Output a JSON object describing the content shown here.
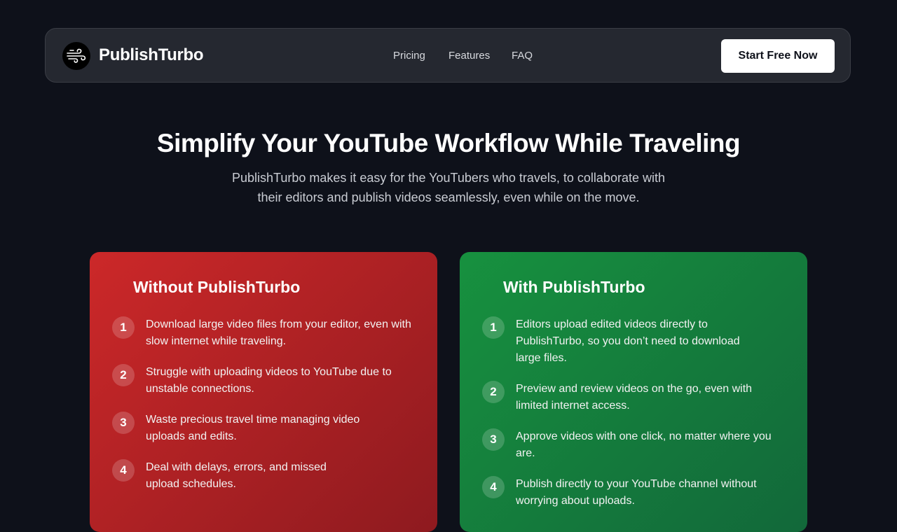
{
  "nav": {
    "brand": "PublishTurbo",
    "logo_icon": "wind-icon",
    "links": [
      "Pricing",
      "Features",
      "FAQ"
    ],
    "cta_label": "Start Free Now"
  },
  "hero": {
    "title": "Simplify Your YouTube Workflow While Traveling",
    "subtitle_line1": "PublishTurbo makes it easy for the YouTubers who travels, to collaborate with",
    "subtitle_line2": "their editors and publish videos seamlessly, even while on the move."
  },
  "without": {
    "title": "Without PublishTurbo",
    "color": "#cc2829",
    "items": [
      {
        "num": "1",
        "text": "Download large video files from your editor, even with slow internet while traveling."
      },
      {
        "num": "2",
        "text": "Struggle with uploading videos to YouTube due to unstable connections."
      },
      {
        "num": "3",
        "text": "Waste precious travel time managing video uploads and edits."
      },
      {
        "num": "4",
        "text": "Deal with delays, errors, and missed upload schedules."
      }
    ]
  },
  "with": {
    "title": "With PublishTurbo",
    "color": "#17913f",
    "items": [
      {
        "num": "1",
        "text": "Editors upload edited videos directly to PublishTurbo, so you don’t need to download large files."
      },
      {
        "num": "2",
        "text": "Preview and review videos on the go, even with limited internet access."
      },
      {
        "num": "3",
        "text": "Approve videos with one click, no matter where you are."
      },
      {
        "num": "4",
        "text": "Publish directly to your YouTube channel without worrying about uploads."
      }
    ]
  }
}
